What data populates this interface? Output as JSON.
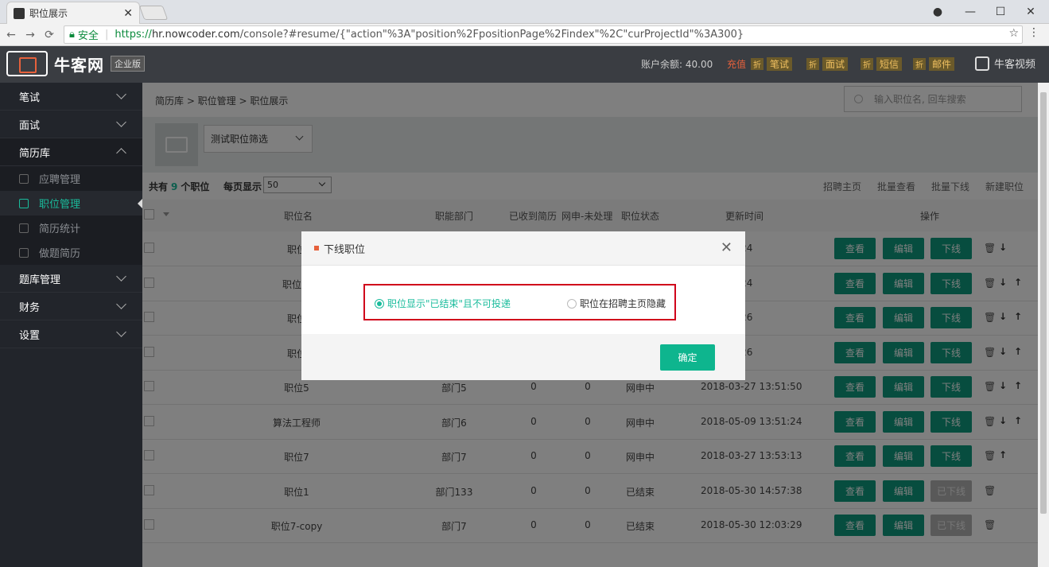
{
  "browser": {
    "tab_title": "职位展示",
    "secure_label": "安全",
    "url_scheme": "https://",
    "url_host": "hr.nowcoder.com",
    "url_path": "/console?#resume/{\"action\"%3A\"position%2FpositionPage%2Findex\"%2C\"curProjectId\"%3A300}"
  },
  "header": {
    "logo_name": "牛客网",
    "logo_badge": "企业版",
    "balance": "账户余额: 40.00",
    "recharge": "充值",
    "discount": "折",
    "tags": [
      "笔试",
      "面试",
      "短信",
      "邮件"
    ],
    "video": "牛客视频"
  },
  "sidebar": {
    "items": [
      {
        "label": "笔试"
      },
      {
        "label": "面试"
      },
      {
        "label": "简历库"
      },
      {
        "label": "题库管理"
      },
      {
        "label": "财务"
      },
      {
        "label": "设置"
      }
    ],
    "sub": [
      {
        "label": "应聘管理"
      },
      {
        "label": "职位管理"
      },
      {
        "label": "简历统计"
      },
      {
        "label": "做题简历"
      }
    ]
  },
  "main": {
    "breadcrumb": "简历库 > 职位管理 > 职位展示",
    "search_placeholder": "输入职位名, 回车搜索",
    "filter_label": "测试职位筛选",
    "total_prefix": "共有",
    "total_count": "9",
    "total_suffix": "个职位",
    "per_page_label": "每页显示",
    "per_page_value": "50",
    "actions": [
      "招聘主页",
      "批量查看",
      "批量下线",
      "新建职位"
    ],
    "columns": [
      "职位名",
      "职能部门",
      "已收到简历",
      "网申-未处理",
      "职位状态",
      "更新时间",
      "操作"
    ],
    "btn_view": "查看",
    "btn_edit": "编辑",
    "btn_offline": "下线",
    "btn_offlined": "已下线",
    "rows": [
      {
        "name": "职位",
        "dept": "",
        "recv": "",
        "pending": "",
        "status": "",
        "time": "4 10:15:24",
        "offline": "下线"
      },
      {
        "name": "职位1-",
        "dept": "",
        "recv": "",
        "pending": "",
        "status": "",
        "time": "4 10:15:24",
        "offline": "下线"
      },
      {
        "name": "职位",
        "dept": "",
        "recv": "",
        "pending": "",
        "status": "",
        "time": "4 10:15:26",
        "offline": "下线"
      },
      {
        "name": "职位",
        "dept": "",
        "recv": "",
        "pending": "",
        "status": "",
        "time": "4 10:15:26",
        "offline": "下线"
      },
      {
        "name": "职位5",
        "dept": "部门5",
        "recv": "0",
        "pending": "0",
        "status": "网申中",
        "time": "2018-03-27 13:51:50",
        "offline": "下线"
      },
      {
        "name": "算法工程师",
        "dept": "部门6",
        "recv": "0",
        "pending": "0",
        "status": "网申中",
        "time": "2018-05-09 13:51:24",
        "offline": "下线"
      },
      {
        "name": "职位7",
        "dept": "部门7",
        "recv": "0",
        "pending": "0",
        "status": "网申中",
        "time": "2018-03-27 13:53:13",
        "offline": "下线"
      },
      {
        "name": "职位1",
        "dept": "部门133",
        "recv": "0",
        "pending": "0",
        "status": "已结束",
        "time": "2018-05-30 14:57:38",
        "offline": "已下线"
      },
      {
        "name": "职位7-copy",
        "dept": "部门7",
        "recv": "0",
        "pending": "0",
        "status": "已结束",
        "time": "2018-05-30 12:03:29",
        "offline": "已下线"
      }
    ]
  },
  "modal": {
    "title": "下线职位",
    "option1": "职位显示\"已结束\"且不可投递",
    "option2": "职位在招聘主页隐藏",
    "confirm": "确定"
  }
}
